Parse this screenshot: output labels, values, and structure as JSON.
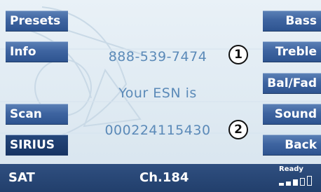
{
  "left_buttons": {
    "presets": "Presets",
    "info": "Info",
    "scan": "Scan",
    "sirius": "SIRIUS"
  },
  "right_buttons": {
    "bass": "Bass",
    "treble": "Treble",
    "balfad": "Bal/Fad",
    "sound": "Sound",
    "back": "Back"
  },
  "main": {
    "phone": "888-539-7474",
    "esn_label": "Your ESN is",
    "esn_value": "000224115430",
    "callout_1": "1",
    "callout_2": "2"
  },
  "status": {
    "band": "SAT",
    "channel": "Ch.184",
    "ready": "Ready",
    "signal_level": 3,
    "signal_max": 5
  },
  "colors": {
    "button": "#3e64a0",
    "button_selected": "#173463",
    "status_bar": "#2f4f80",
    "info_text": "#5b8ab8",
    "background": "#e4eef5"
  }
}
